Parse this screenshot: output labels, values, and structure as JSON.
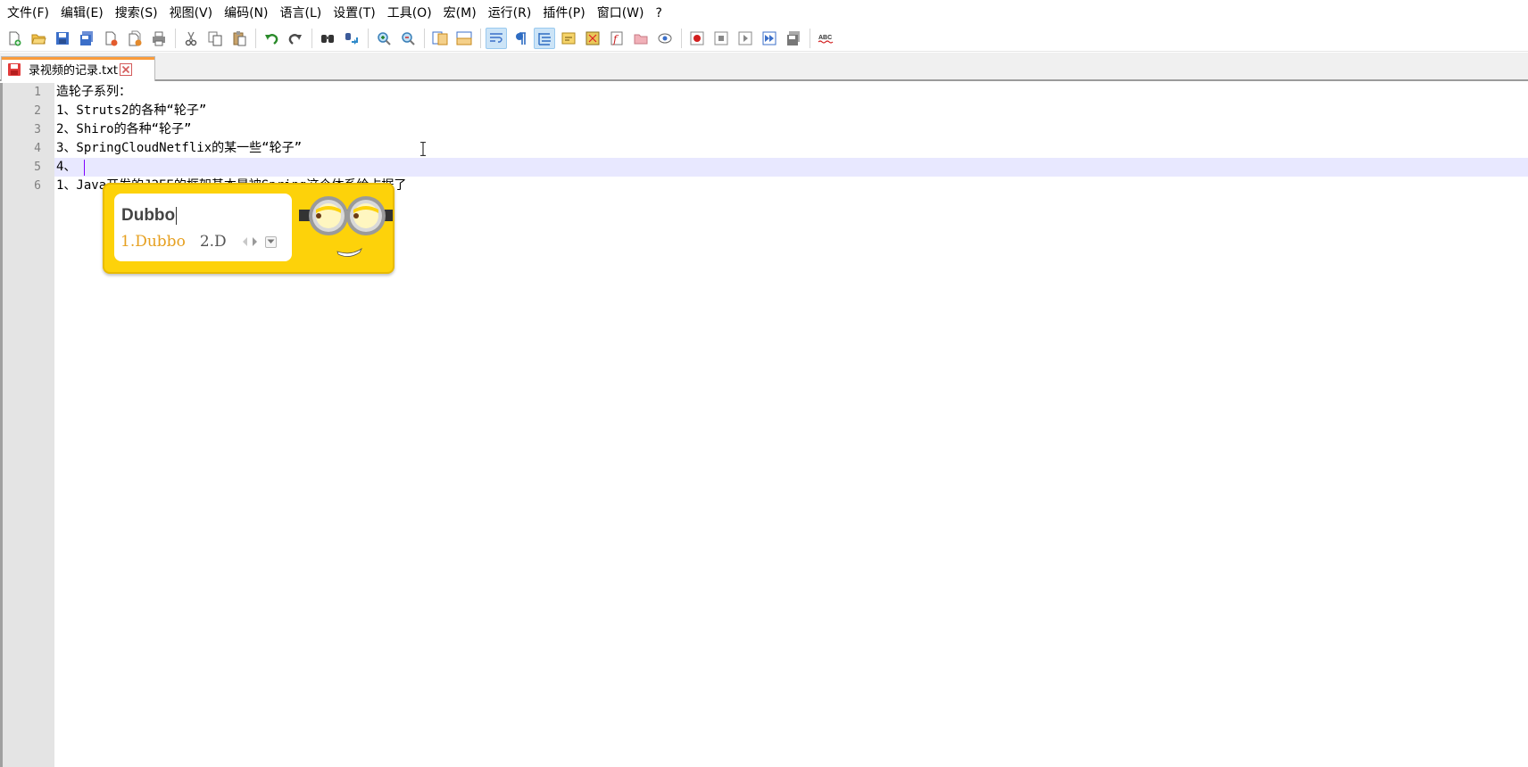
{
  "menu": [
    "文件(F)",
    "编辑(E)",
    "搜索(S)",
    "视图(V)",
    "编码(N)",
    "语言(L)",
    "设置(T)",
    "工具(O)",
    "宏(M)",
    "运行(R)",
    "插件(P)",
    "窗口(W)",
    "?"
  ],
  "toolbar": {
    "icons": [
      "new-file-icon",
      "open-file-icon",
      "save-icon",
      "save-all-icon",
      "close-icon",
      "close-all-icon",
      "print-icon",
      "cut-icon",
      "copy-icon",
      "paste-icon",
      "undo-icon",
      "redo-icon",
      "find-icon",
      "replace-icon",
      "zoom-in-icon",
      "zoom-out-icon",
      "sync-vertical-icon",
      "sync-horizontal-icon",
      "word-wrap-icon",
      "show-all-chars-icon",
      "indent-guide-icon",
      "user-lang-icon",
      "doc-map-icon",
      "function-list-icon",
      "folder-workspace-icon",
      "monitoring-icon",
      "record-macro-icon",
      "stop-record-icon",
      "play-macro-icon",
      "run-macro-multiple-icon",
      "save-macro-icon",
      "spell-check-icon"
    ],
    "spell_check_text": "ABC"
  },
  "tab": {
    "label": "录视频的记录.txt",
    "accent_color": "#fa9b3a"
  },
  "editor": {
    "line_numbers": [
      "1",
      "2",
      "3",
      "4",
      "5",
      "6"
    ],
    "lines": [
      "造轮子系列：",
      "1、Struts2的各种“轮子”",
      "2、Shiro的各种“轮子”",
      "3、SpringCloudNetflix的某一些“轮子”",
      "4、",
      "1、Java开发的J2EE的框架基本是被Spring这个体系给占据了"
    ],
    "current_line_color": "#e8e8ff",
    "caret_color": "#8000ff"
  },
  "ime": {
    "composition": "Dubbo",
    "candidates": [
      "1.Dubbo",
      "2.D"
    ],
    "selected_color": "#e6a020",
    "skin_color": "#fdd20a",
    "mascot": "minion-goggles-icon"
  }
}
